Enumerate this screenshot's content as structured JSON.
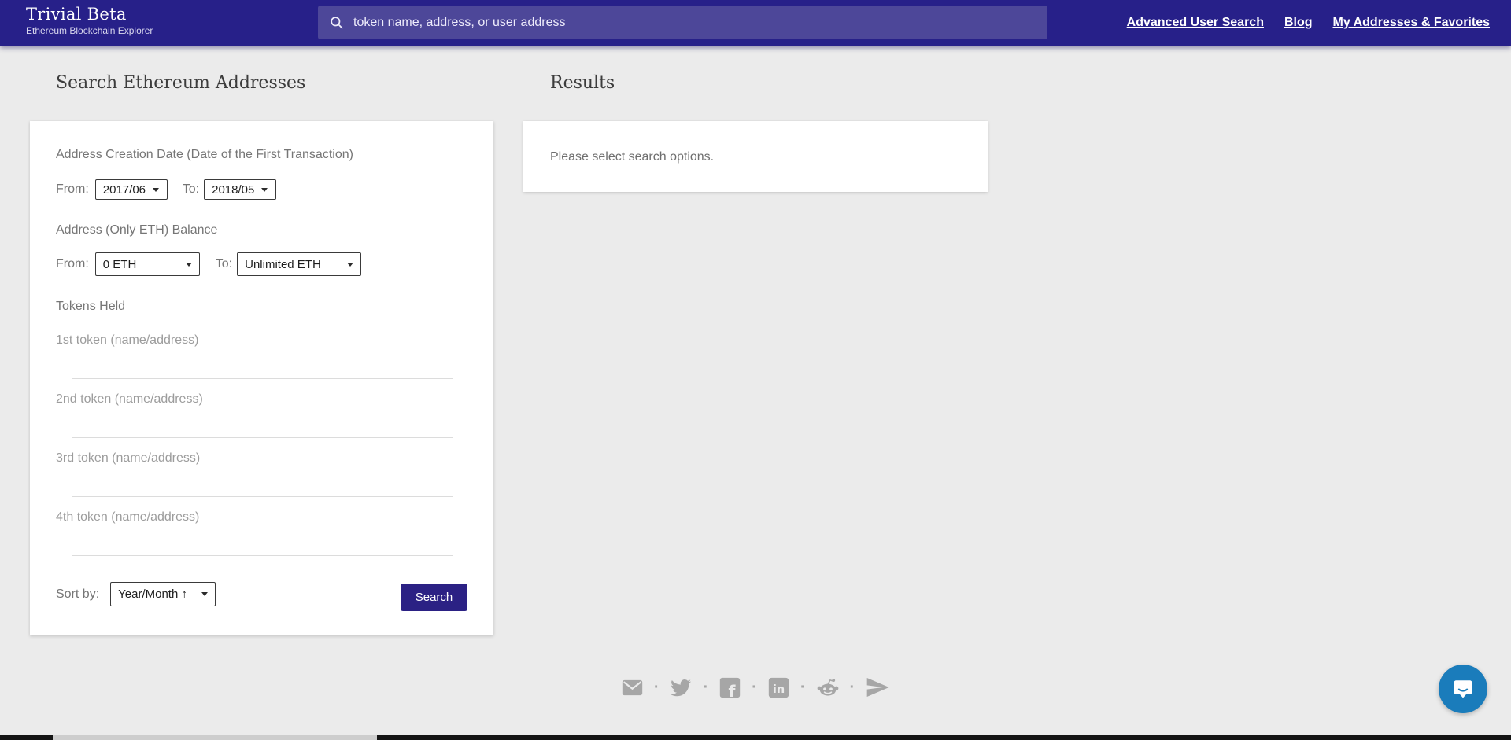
{
  "header": {
    "title": "Trivial Beta",
    "subtitle": "Ethereum Blockchain Explorer",
    "search_placeholder": "token name, address, or user address",
    "nav": [
      {
        "label": "Advanced User Search"
      },
      {
        "label": "Blog"
      },
      {
        "label": "My Addresses & Favorites"
      }
    ]
  },
  "search_panel": {
    "heading": "Search Ethereum Addresses",
    "creation_date": {
      "label": "Address Creation Date (Date of the First Transaction)",
      "from_label": "From:",
      "from_value": "2017/06",
      "to_label": "To:",
      "to_value": "2018/05"
    },
    "balance": {
      "label": "Address (Only ETH) Balance",
      "from_label": "From:",
      "from_value": "0 ETH",
      "to_label": "To:",
      "to_value": "Unlimited ETH"
    },
    "tokens": {
      "label": "Tokens Held",
      "fields": [
        {
          "label": "1st token (name/address)",
          "value": ""
        },
        {
          "label": "2nd token (name/address)",
          "value": ""
        },
        {
          "label": "3rd token (name/address)",
          "value": ""
        },
        {
          "label": "4th token (name/address)",
          "value": ""
        }
      ]
    },
    "sort": {
      "label": "Sort by:",
      "value": "Year/Month ↑"
    },
    "search_button_label": "Search"
  },
  "results_panel": {
    "heading": "Results",
    "message": "Please select search options."
  },
  "footer": {
    "separator": "·",
    "social_icons": [
      "email-icon",
      "twitter-icon",
      "facebook-icon",
      "linkedin-icon",
      "reddit-icon",
      "telegram-icon"
    ]
  },
  "colors": {
    "header_bg": "#272089",
    "search_input_bg": "#4d4799",
    "page_bg": "#ebebeb",
    "accent_button": "#2b2184",
    "chat_button": "#1a7cbb",
    "social_icon": "#a6a6a6"
  }
}
